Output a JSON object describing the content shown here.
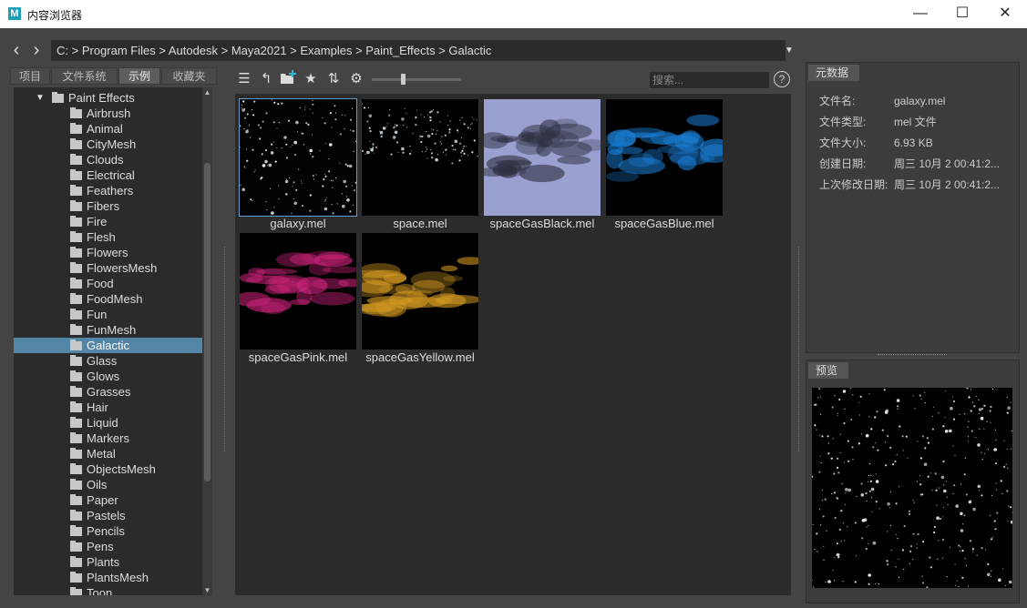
{
  "window": {
    "title": "内容浏览器",
    "logo": "M",
    "minimize": "—",
    "maximize": "☐",
    "close": "✕"
  },
  "nav": {
    "back": "‹",
    "forward": "›",
    "path": "C:  >  Program Files  >  Autodesk  >  Maya2021  >  Examples  >  Paint_Effects  >  Galactic",
    "dropdown": "▼"
  },
  "left_tabs": [
    {
      "label": "项目",
      "active": false
    },
    {
      "label": "文件系统",
      "active": false
    },
    {
      "label": "示例",
      "active": true
    },
    {
      "label": "收藏夹",
      "active": false
    }
  ],
  "tree": {
    "root": "Paint Effects",
    "selected": "Galactic",
    "items": [
      "Airbrush",
      "Animal",
      "CityMesh",
      "Clouds",
      "Electrical",
      "Feathers",
      "Fibers",
      "Fire",
      "Flesh",
      "Flowers",
      "FlowersMesh",
      "Food",
      "FoodMesh",
      "Fun",
      "FunMesh",
      "Galactic",
      "Glass",
      "Glows",
      "Grasses",
      "Hair",
      "Liquid",
      "Markers",
      "Metal",
      "ObjectsMesh",
      "Oils",
      "Paper",
      "Pastels",
      "Pencils",
      "Pens",
      "Plants",
      "PlantsMesh",
      "Toon"
    ]
  },
  "toolbar": {
    "search_placeholder": "搜索...",
    "help": "?",
    "thumbnail_size_level": 0.35
  },
  "files": [
    {
      "name": "galaxy.mel",
      "selected": true,
      "bg": "#020202",
      "star_color": "#dfe9f0"
    },
    {
      "name": "space.mel",
      "selected": false,
      "bg": "#000000",
      "star_color": "#cfe0ea"
    },
    {
      "name": "spaceGasBlack.mel",
      "selected": false,
      "bg": "#9aa0cf",
      "gas_color": "#2e3142"
    },
    {
      "name": "spaceGasBlue.mel",
      "selected": false,
      "bg": "#000000",
      "gas_color": "#1a7fd6"
    },
    {
      "name": "spaceGasPink.mel",
      "selected": false,
      "bg": "#000000",
      "gas_color": "#d2247e"
    },
    {
      "name": "spaceGasYellow.mel",
      "selected": false,
      "bg": "#000000",
      "gas_color": "#d49a22"
    }
  ],
  "metadata": {
    "title": "元数据",
    "rows": [
      {
        "label": "文件名:",
        "value": "galaxy.mel"
      },
      {
        "label": "文件类型:",
        "value": "mel 文件"
      },
      {
        "label": "文件大小:",
        "value": "6.93 KB"
      },
      {
        "label": "创建日期:",
        "value": "周三 10月 2 00:41:2..."
      },
      {
        "label": "上次修改日期:",
        "value": "周三 10月 2 00:41:2..."
      }
    ]
  },
  "preview": {
    "title": "预览"
  },
  "colors": {
    "selection": "#5285a6",
    "panel_dark": "#2b2b2b",
    "frame": "#444444"
  },
  "icons": {
    "list_view": "☰",
    "up_folder": "↰",
    "new_folder": "▆",
    "favorite": "★",
    "sort": "⇅",
    "settings": "⚙"
  }
}
